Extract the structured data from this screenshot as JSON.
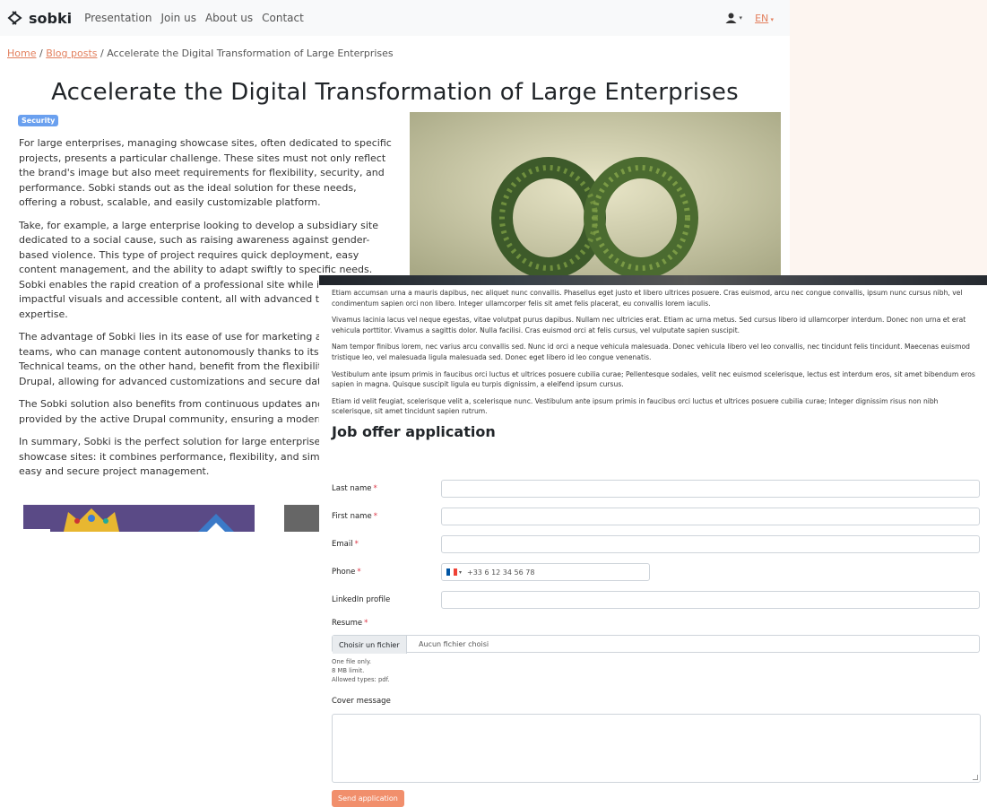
{
  "nav": {
    "brand": "sobki",
    "links": [
      "Presentation",
      "Join us",
      "About us",
      "Contact"
    ],
    "language": "EN"
  },
  "breadcrumb": {
    "home": "Home",
    "section": "Blog posts",
    "current": "Accelerate the Digital Transformation of Large Enterprises"
  },
  "article": {
    "title": "Accelerate the Digital Transformation of Large Enterprises",
    "tag": "Security",
    "paragraphs": [
      "For large enterprises, managing showcase sites, often dedicated to specific projects, presents a particular challenge. These sites must not only reflect the brand's image but also meet requirements for flexibility, security, and performance. Sobki stands out as the ideal solution for these needs, offering a robust, scalable, and easily customizable platform.",
      "Take, for example, a large enterprise looking to develop a subsidiary site dedicated to a social cause, such as raising awareness against gender-based violence. This type of project requires quick deployment, easy content management, and the ability to adapt swiftly to specific needs. Sobki enables the rapid creation of a professional site while integrating impactful visuals and accessible content, all with advanced technical expertise.",
      "The advantage of Sobki lies in its ease of use for marketing and comm teams, who can manage content autonomously thanks to its intuitive i Technical teams, on the other hand, benefit from the flexibility and ro Drupal, allowing for advanced customizations and secure data manage",
      "The Sobki solution also benefits from continuous updates and improve provided by the active Drupal community, ensuring a modern and scal",
      "In summary, Sobki is the perfect solution for large enterprises looking showcase sites: it combines performance, flexibility, and simplicity, wh easy and secure project management."
    ]
  },
  "job": {
    "lorem": [
      "Etiam accumsan urna a mauris dapibus, nec aliquet nunc convallis. Phasellus eget justo et libero ultrices posuere. Cras euismod, arcu nec congue convallis, ipsum nunc cursus nibh, vel condimentum sapien orci non libero. Integer ullamcorper felis sit amet felis placerat, eu convallis lorem iaculis.",
      "Vivamus lacinia lacus vel neque egestas, vitae volutpat purus dapibus. Nullam nec ultricies erat. Etiam ac urna metus. Sed cursus libero id ullamcorper interdum. Donec non urna et erat vehicula porttitor. Vivamus a sagittis dolor. Nulla facilisi. Cras euismod orci at felis cursus, vel vulputate sapien suscipit.",
      "Nam tempor finibus lorem, nec varius arcu convallis sed. Nunc id orci a neque vehicula malesuada. Donec vehicula libero vel leo convallis, nec tincidunt felis tincidunt. Maecenas euismod tristique leo, vel malesuada ligula malesuada sed. Donec eget libero id leo congue venenatis.",
      "Vestibulum ante ipsum primis in faucibus orci luctus et ultrices posuere cubilia curae; Pellentesque sodales, velit nec euismod scelerisque, lectus est interdum eros, sit amet bibendum eros sapien in magna. Quisque suscipit ligula eu turpis dignissim, a eleifend ipsum cursus.",
      "Etiam id velit feugiat, scelerisque velit a, scelerisque nunc. Vestibulum ante ipsum primis in faucibus orci luctus et ultrices posuere cubilia curae; Integer dignissim risus non nibh scelerisque, sit amet tincidunt sapien rutrum."
    ],
    "form_title": "Job offer application",
    "fields": {
      "last_name": "Last name",
      "first_name": "First name",
      "email": "Email",
      "phone": "Phone",
      "phone_placeholder": "+33 6 12 34 56 78",
      "linkedin": "LinkedIn profile",
      "resume": "Resume",
      "file_button": "Choisir un fichier",
      "file_status": "Aucun fichier choisi",
      "help_1": "One file only.",
      "help_2": "8 MB limit.",
      "help_3": "Allowed types: pdf.",
      "cover": "Cover message"
    },
    "required_mark": "*",
    "submit": "Send application"
  },
  "colors": {
    "accent": "#e3805e",
    "badge": "#6aa0ef",
    "submit": "#f18f6c",
    "required": "#dc3545"
  }
}
